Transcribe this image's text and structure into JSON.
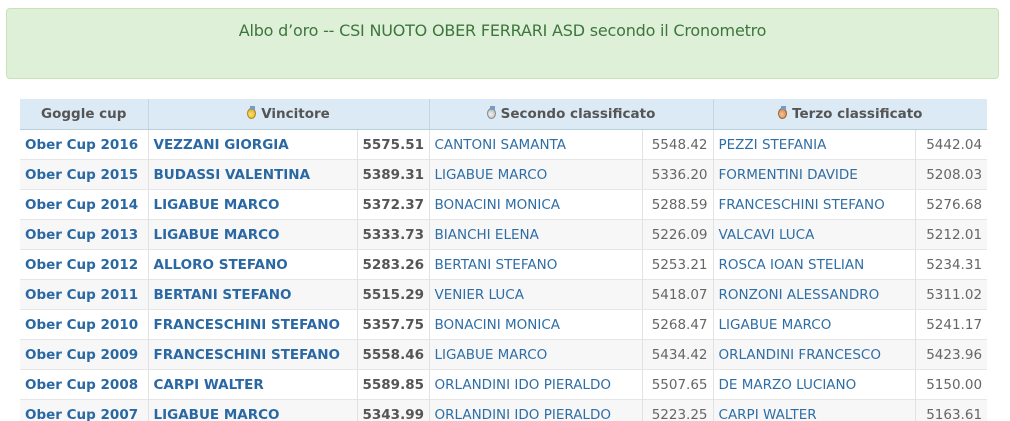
{
  "banner": {
    "title": "Albo d’oro -- CSI NUOTO OBER FERRARI ASD secondo il Cronometro"
  },
  "table": {
    "headers": {
      "cup": "Goggle cup",
      "winner": "Vincitore",
      "second": "Secondo classificato",
      "third": "Terzo classificato"
    },
    "medal_icons": {
      "winner": "gold-medal-icon",
      "second": "silver-medal-icon",
      "third": "bronze-medal-icon"
    },
    "rows": [
      {
        "cup": "Ober Cup 2016",
        "winner": "VEZZANI GIORGIA",
        "winner_time": "5575.51",
        "second": "CANTONI SAMANTA",
        "second_time": "5548.42",
        "third": "PEZZI STEFANIA",
        "third_time": "5442.04"
      },
      {
        "cup": "Ober Cup 2015",
        "winner": "BUDASSI VALENTINA",
        "winner_time": "5389.31",
        "second": "LIGABUE MARCO",
        "second_time": "5336.20",
        "third": "FORMENTINI DAVIDE",
        "third_time": "5208.03"
      },
      {
        "cup": "Ober Cup 2014",
        "winner": "LIGABUE MARCO",
        "winner_time": "5372.37",
        "second": "BONACINI MONICA",
        "second_time": "5288.59",
        "third": "FRANCESCHINI STEFANO",
        "third_time": "5276.68"
      },
      {
        "cup": "Ober Cup 2013",
        "winner": "LIGABUE MARCO",
        "winner_time": "5333.73",
        "second": "BIANCHI ELENA",
        "second_time": "5226.09",
        "third": "VALCAVI LUCA",
        "third_time": "5212.01"
      },
      {
        "cup": "Ober Cup 2012",
        "winner": "ALLORO STEFANO",
        "winner_time": "5283.26",
        "second": "BERTANI STEFANO",
        "second_time": "5253.21",
        "third": "ROSCA IOAN STELIAN",
        "third_time": "5234.31"
      },
      {
        "cup": "Ober Cup 2011",
        "winner": "BERTANI STEFANO",
        "winner_time": "5515.29",
        "second": "VENIER LUCA",
        "second_time": "5418.07",
        "third": "RONZONI ALESSANDRO",
        "third_time": "5311.02"
      },
      {
        "cup": "Ober Cup 2010",
        "winner": "FRANCESCHINI STEFANO",
        "winner_time": "5357.75",
        "second": "BONACINI MONICA",
        "second_time": "5268.47",
        "third": "LIGABUE MARCO",
        "third_time": "5241.17"
      },
      {
        "cup": "Ober Cup 2009",
        "winner": "FRANCESCHINI STEFANO",
        "winner_time": "5558.46",
        "second": "LIGABUE MARCO",
        "second_time": "5434.42",
        "third": "ORLANDINI FRANCESCO",
        "third_time": "5423.96"
      },
      {
        "cup": "Ober Cup 2008",
        "winner": "CARPI WALTER",
        "winner_time": "5589.85",
        "second": "ORLANDINI IDO PIERALDO",
        "second_time": "5507.65",
        "third": "DE MARZO LUCIANO",
        "third_time": "5150.00"
      },
      {
        "cup": "Ober Cup 2007",
        "winner": "LIGABUE MARCO",
        "winner_time": "5343.99",
        "second": "ORLANDINI IDO PIERALDO",
        "second_time": "5223.25",
        "third": "CARPI WALTER",
        "third_time": "5163.61"
      }
    ]
  }
}
